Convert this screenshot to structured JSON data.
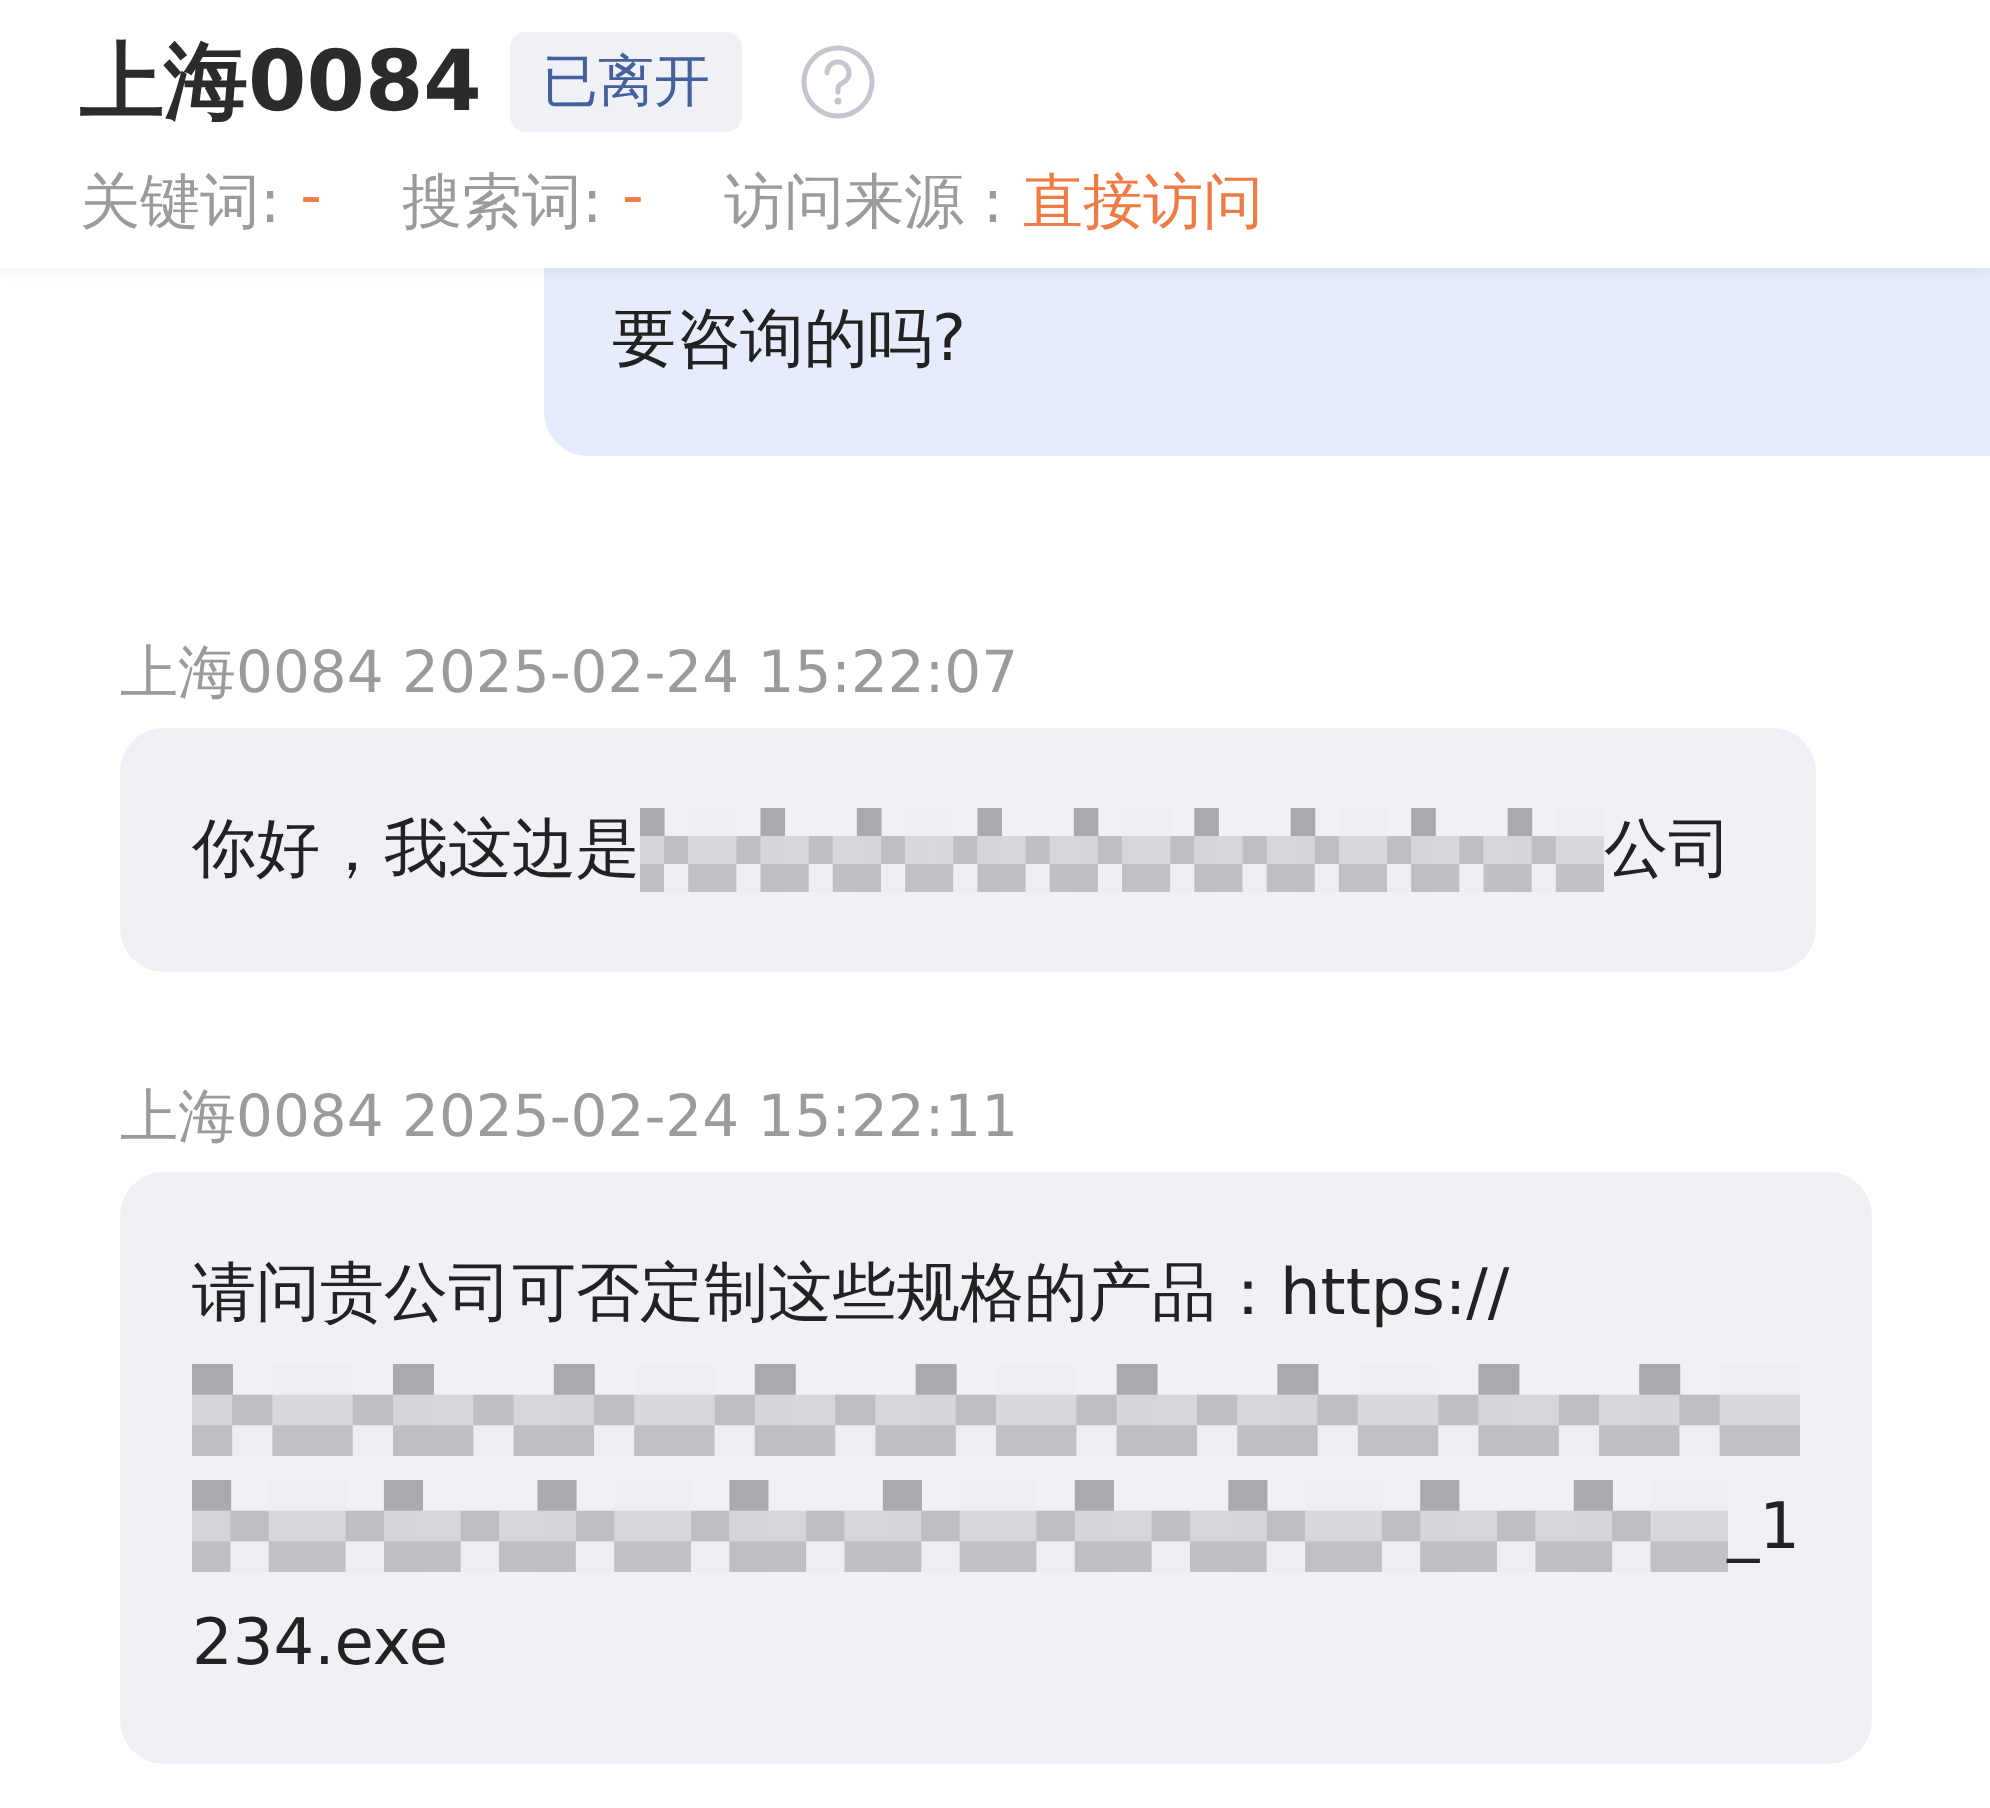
{
  "header": {
    "title": "上海0084",
    "status_tag": "已离开",
    "meta": [
      {
        "label": "关键词:",
        "value": "-"
      },
      {
        "label": "搜索词:",
        "value": "-"
      },
      {
        "label": "访问来源 :",
        "value": "直接访问"
      }
    ]
  },
  "messages": [
    {
      "kind": "agent",
      "lines": [
        [
          {
            "kind": "text",
            "text": "要咨询的吗?"
          }
        ]
      ]
    },
    {
      "kind": "visitor",
      "sender": "上海0084",
      "time": "2025-02-24 15:22:07",
      "lines": [
        [
          {
            "kind": "text",
            "text": "你好，我这边是"
          },
          {
            "kind": "redacted"
          },
          {
            "kind": "text",
            "text": "公司"
          }
        ]
      ]
    },
    {
      "kind": "visitor",
      "sender": "上海0084",
      "time": "2025-02-24 15:22:11",
      "lines": [
        [
          {
            "kind": "text",
            "text": "请问贵公司可否定制这些规格的产品：https://"
          }
        ],
        [
          {
            "kind": "redacted"
          }
        ],
        [
          {
            "kind": "redacted"
          },
          {
            "kind": "text",
            "text": "_1"
          }
        ],
        [
          {
            "kind": "text",
            "text": "234.exe"
          }
        ]
      ]
    }
  ]
}
